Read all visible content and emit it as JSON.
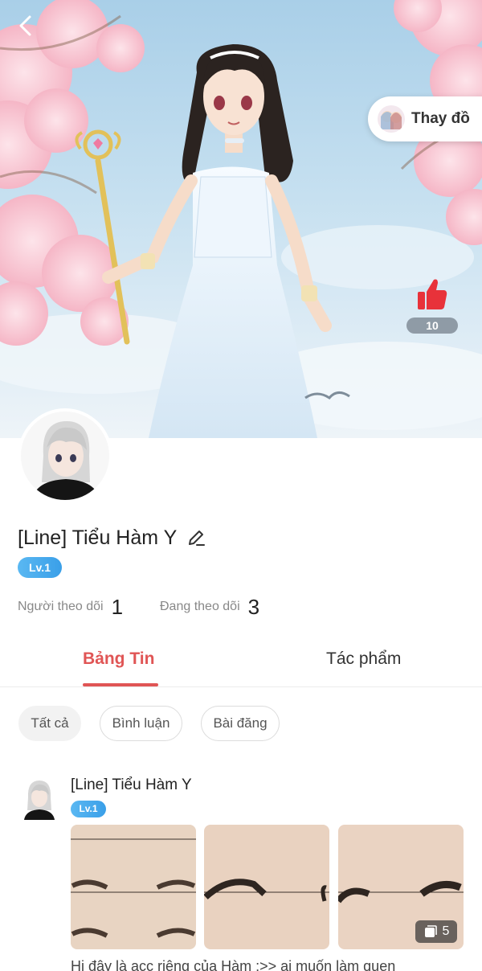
{
  "hero": {
    "change_outfit_label": "Thay đồ",
    "like_count": "10"
  },
  "profile": {
    "name": "[Line] Tiểu Hàm Y",
    "level": "Lv.1",
    "followers_label": "Người theo dõi",
    "followers_count": "1",
    "following_label": "Đang theo dõi",
    "following_count": "3"
  },
  "tabs": [
    {
      "label": "Bảng Tin",
      "active": true
    },
    {
      "label": "Tác phẩm",
      "active": false
    }
  ],
  "filters": [
    {
      "label": "Tất cả",
      "active": true
    },
    {
      "label": "Bình luận",
      "active": false
    },
    {
      "label": "Bài đăng",
      "active": false
    }
  ],
  "post": {
    "author": "[Line] Tiểu Hàm Y",
    "level": "Lv.1",
    "image_count": "5",
    "text": "Hi đây là acc riêng của Hàm :>> ai muốn làm quen"
  },
  "colors": {
    "accent": "#e05555",
    "level_badge": "#3a9fe8",
    "like": "#e8323a"
  },
  "icons": [
    "back-arrow-icon",
    "edit-pencil-icon",
    "thumbs-up-icon",
    "image-stack-icon"
  ]
}
